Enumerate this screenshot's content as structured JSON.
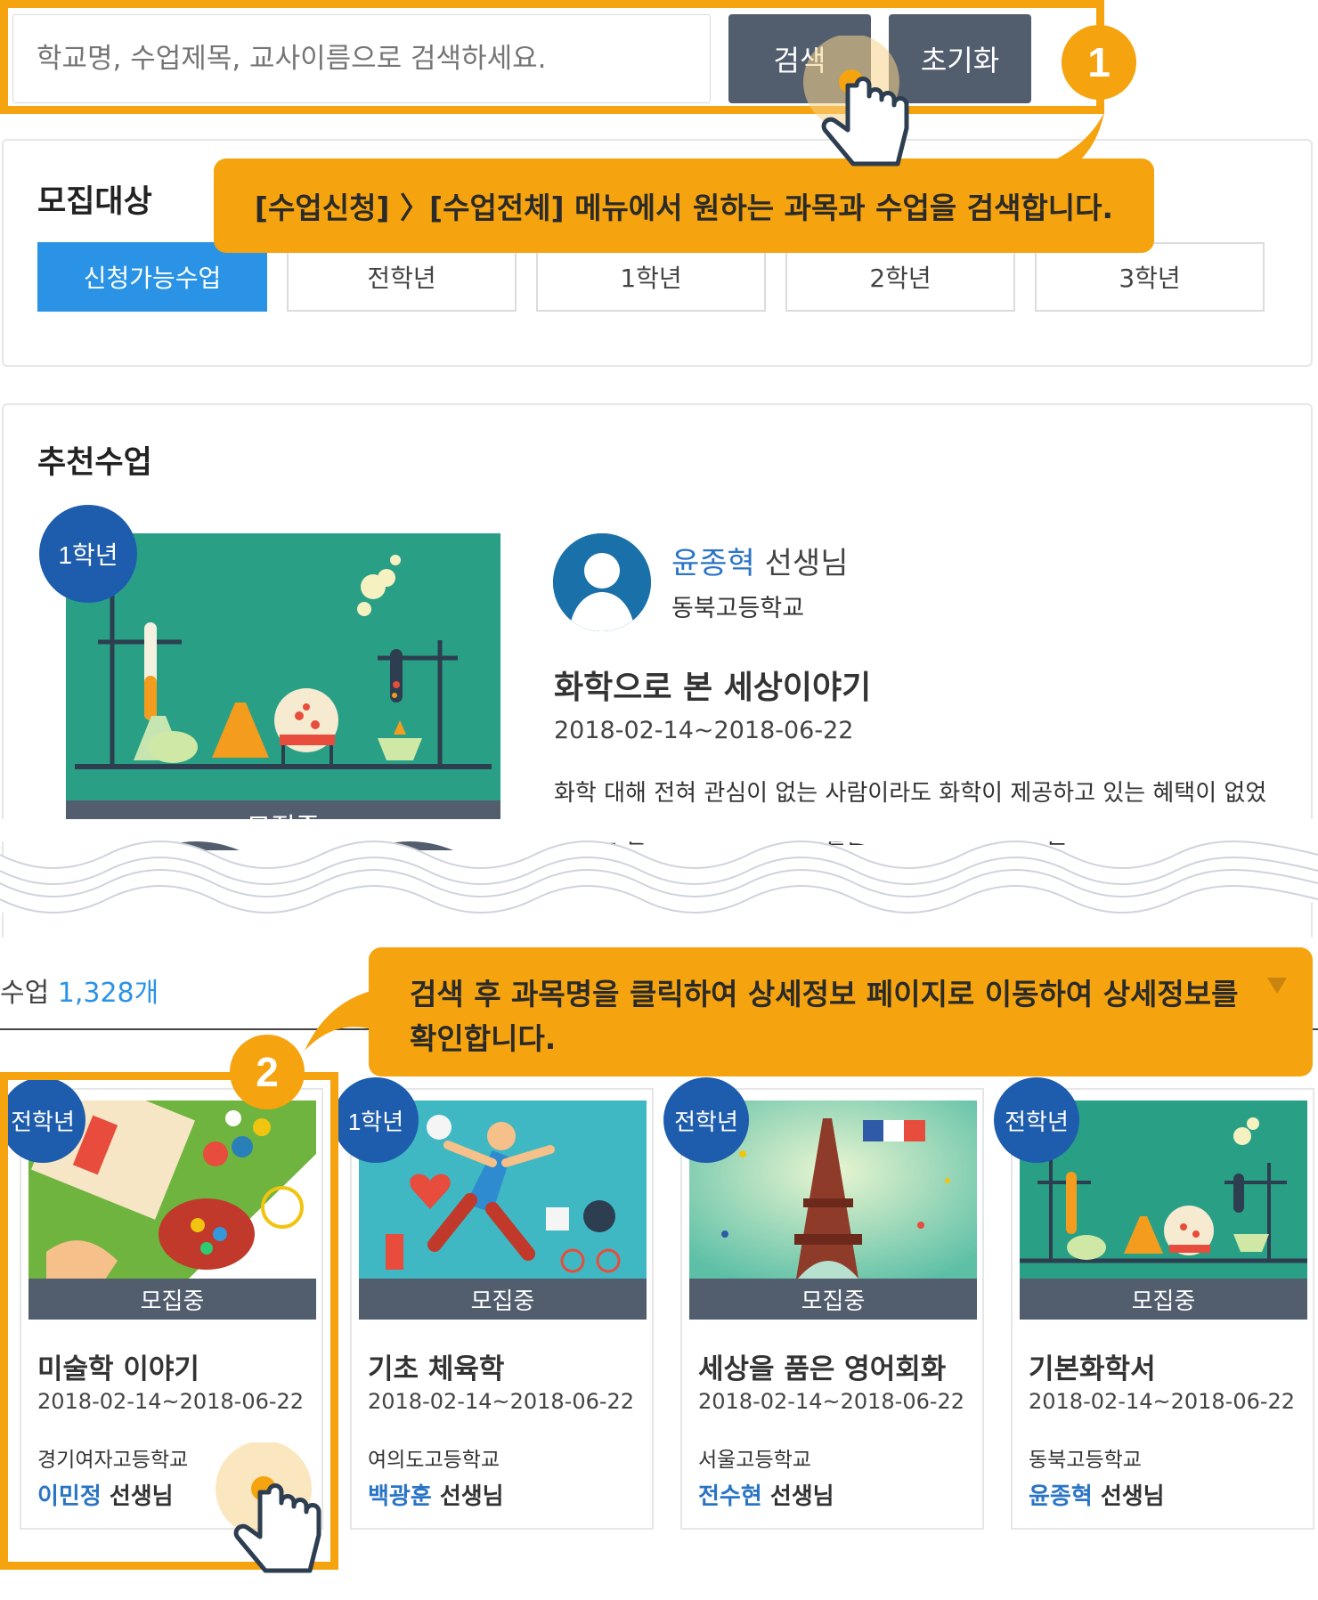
{
  "search": {
    "placeholder": "학교명, 수업제목, 교사이름으로 검색하세요.",
    "search_label": "검색",
    "reset_label": "초기화"
  },
  "steps": {
    "one": "1",
    "two": "2"
  },
  "callouts": {
    "first": "[수업신청] 〉[수업전체] 메뉴에서 원하는 과목과 수업을 검색합니다.",
    "second": "검색 후 과목명을 클릭하여 상세정보 페이지로 이동하여 상세정보를 확인합니다."
  },
  "target": {
    "title": "모집대상",
    "tabs": [
      {
        "label": "신청가능수업",
        "active": true
      },
      {
        "label": "전학년"
      },
      {
        "label": "1학년"
      },
      {
        "label": "2학년"
      },
      {
        "label": "3학년"
      }
    ]
  },
  "recommended": {
    "title": "추천수업",
    "grade": "1학년",
    "status": "모집중",
    "teacher_name": "윤종혁",
    "teacher_suffix": " 선생님",
    "school": "동북고등학교",
    "course_title": "화학으로 본 세상이야기",
    "date": "2018-02-14~2018-06-22",
    "description": "화학 대해 전혀 관심이 없는 사람이라도 화학이 제공하고 있는 혜택이 없었더라면 단 몇 분도 평범한 생활을 이어갈 수 없다는 놀라운 사실"
  },
  "list": {
    "count_prefix": "수업 ",
    "count_value": "1,328개",
    "cards": [
      {
        "grade": "전학년",
        "status": "모집중",
        "title": "미술학 이야기",
        "date": "2018-02-14~2018-06-22",
        "school": "경기여자고등학교",
        "teacher": "이민정",
        "suffix": " 선생님"
      },
      {
        "grade": "1학년",
        "status": "모집중",
        "title": "기초 체육학",
        "date": "2018-02-14~2018-06-22",
        "school": "여의도고등학교",
        "teacher": "백광훈",
        "suffix": " 선생님"
      },
      {
        "grade": "전학년",
        "status": "모집중",
        "title": "세상을 품은 영어회화",
        "date": "2018-02-14~2018-06-22",
        "school": "서울고등학교",
        "teacher": "전수현",
        "suffix": " 선생님"
      },
      {
        "grade": "전학년",
        "status": "모집중",
        "title": "기본화학서",
        "date": "2018-02-14~2018-06-22",
        "school": "동북고등학교",
        "teacher": "윤종혁",
        "suffix": " 선생님"
      }
    ]
  },
  "colors": {
    "accent_orange": "#f5a30e",
    "button_dark": "#525d6e",
    "tab_active": "#2a93e6",
    "grade_badge": "#1e5dad",
    "link_blue": "#2a74c6"
  },
  "icons": [
    "pointer-hand-icon",
    "user-avatar-icon",
    "dropdown-arrow-icon"
  ]
}
